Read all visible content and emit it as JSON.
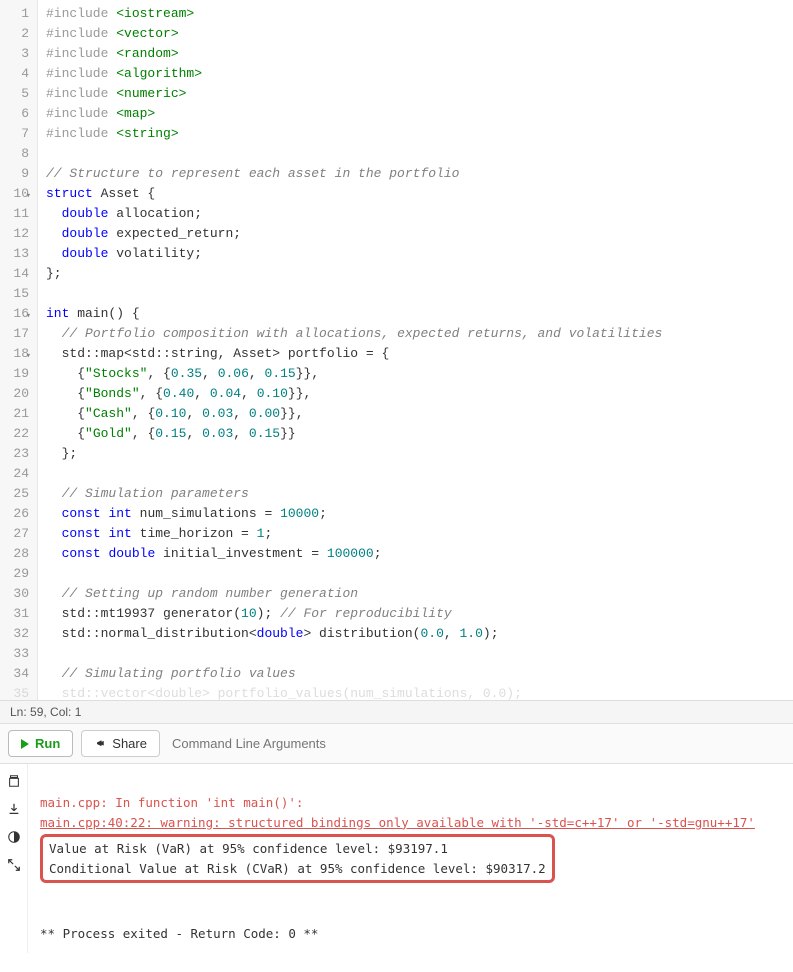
{
  "editor": {
    "lines": [
      {
        "n": 1,
        "tokens": [
          [
            "preproc",
            "#include "
          ],
          [
            "string",
            "<iostream>"
          ]
        ]
      },
      {
        "n": 2,
        "tokens": [
          [
            "preproc",
            "#include "
          ],
          [
            "string",
            "<vector>"
          ]
        ]
      },
      {
        "n": 3,
        "tokens": [
          [
            "preproc",
            "#include "
          ],
          [
            "string",
            "<random>"
          ]
        ]
      },
      {
        "n": 4,
        "tokens": [
          [
            "preproc",
            "#include "
          ],
          [
            "string",
            "<algorithm>"
          ]
        ]
      },
      {
        "n": 5,
        "tokens": [
          [
            "preproc",
            "#include "
          ],
          [
            "string",
            "<numeric>"
          ]
        ]
      },
      {
        "n": 6,
        "tokens": [
          [
            "preproc",
            "#include "
          ],
          [
            "string",
            "<map>"
          ]
        ]
      },
      {
        "n": 7,
        "tokens": [
          [
            "preproc",
            "#include "
          ],
          [
            "string",
            "<string>"
          ]
        ]
      },
      {
        "n": 8,
        "tokens": []
      },
      {
        "n": 9,
        "tokens": [
          [
            "comment",
            "// Structure to represent each asset in the portfolio"
          ]
        ]
      },
      {
        "n": 10,
        "fold": true,
        "tokens": [
          [
            "keyword",
            "struct"
          ],
          [
            "ident",
            " Asset "
          ],
          [
            "punct",
            "{"
          ]
        ]
      },
      {
        "n": 11,
        "tokens": [
          [
            "ident",
            "  "
          ],
          [
            "type",
            "double"
          ],
          [
            "ident",
            " allocation;"
          ]
        ]
      },
      {
        "n": 12,
        "tokens": [
          [
            "ident",
            "  "
          ],
          [
            "type",
            "double"
          ],
          [
            "ident",
            " expected_return;"
          ]
        ]
      },
      {
        "n": 13,
        "tokens": [
          [
            "ident",
            "  "
          ],
          [
            "type",
            "double"
          ],
          [
            "ident",
            " volatility;"
          ]
        ]
      },
      {
        "n": 14,
        "tokens": [
          [
            "punct",
            "};"
          ]
        ]
      },
      {
        "n": 15,
        "tokens": []
      },
      {
        "n": 16,
        "fold": true,
        "tokens": [
          [
            "type",
            "int"
          ],
          [
            "ident",
            " main() "
          ],
          [
            "punct",
            "{"
          ]
        ]
      },
      {
        "n": 17,
        "tokens": [
          [
            "ident",
            "  "
          ],
          [
            "comment",
            "// Portfolio composition with allocations, expected returns, and volatilities"
          ]
        ]
      },
      {
        "n": 18,
        "fold": true,
        "tokens": [
          [
            "ident",
            "  std::map<std::string, Asset> portfolio = "
          ],
          [
            "punct",
            "{"
          ]
        ]
      },
      {
        "n": 19,
        "tokens": [
          [
            "ident",
            "    "
          ],
          [
            "punct",
            "{"
          ],
          [
            "string",
            "\"Stocks\""
          ],
          [
            "punct",
            ", {"
          ],
          [
            "number",
            "0.35"
          ],
          [
            "punct",
            ", "
          ],
          [
            "number",
            "0.06"
          ],
          [
            "punct",
            ", "
          ],
          [
            "number",
            "0.15"
          ],
          [
            "punct",
            "}},"
          ]
        ]
      },
      {
        "n": 20,
        "tokens": [
          [
            "ident",
            "    "
          ],
          [
            "punct",
            "{"
          ],
          [
            "string",
            "\"Bonds\""
          ],
          [
            "punct",
            ", {"
          ],
          [
            "number",
            "0.40"
          ],
          [
            "punct",
            ", "
          ],
          [
            "number",
            "0.04"
          ],
          [
            "punct",
            ", "
          ],
          [
            "number",
            "0.10"
          ],
          [
            "punct",
            "}},"
          ]
        ]
      },
      {
        "n": 21,
        "tokens": [
          [
            "ident",
            "    "
          ],
          [
            "punct",
            "{"
          ],
          [
            "string",
            "\"Cash\""
          ],
          [
            "punct",
            ", {"
          ],
          [
            "number",
            "0.10"
          ],
          [
            "punct",
            ", "
          ],
          [
            "number",
            "0.03"
          ],
          [
            "punct",
            ", "
          ],
          [
            "number",
            "0.00"
          ],
          [
            "punct",
            "}},"
          ]
        ]
      },
      {
        "n": 22,
        "tokens": [
          [
            "ident",
            "    "
          ],
          [
            "punct",
            "{"
          ],
          [
            "string",
            "\"Gold\""
          ],
          [
            "punct",
            ", {"
          ],
          [
            "number",
            "0.15"
          ],
          [
            "punct",
            ", "
          ],
          [
            "number",
            "0.03"
          ],
          [
            "punct",
            ", "
          ],
          [
            "number",
            "0.15"
          ],
          [
            "punct",
            "}}"
          ]
        ]
      },
      {
        "n": 23,
        "tokens": [
          [
            "ident",
            "  "
          ],
          [
            "punct",
            "};"
          ]
        ]
      },
      {
        "n": 24,
        "tokens": []
      },
      {
        "n": 25,
        "tokens": [
          [
            "ident",
            "  "
          ],
          [
            "comment",
            "// Simulation parameters"
          ]
        ]
      },
      {
        "n": 26,
        "tokens": [
          [
            "ident",
            "  "
          ],
          [
            "keyword",
            "const"
          ],
          [
            "ident",
            " "
          ],
          [
            "type",
            "int"
          ],
          [
            "ident",
            " num_simulations = "
          ],
          [
            "number",
            "10000"
          ],
          [
            "punct",
            ";"
          ]
        ]
      },
      {
        "n": 27,
        "tokens": [
          [
            "ident",
            "  "
          ],
          [
            "keyword",
            "const"
          ],
          [
            "ident",
            " "
          ],
          [
            "type",
            "int"
          ],
          [
            "ident",
            " time_horizon = "
          ],
          [
            "number",
            "1"
          ],
          [
            "punct",
            ";"
          ]
        ]
      },
      {
        "n": 28,
        "tokens": [
          [
            "ident",
            "  "
          ],
          [
            "keyword",
            "const"
          ],
          [
            "ident",
            " "
          ],
          [
            "type",
            "double"
          ],
          [
            "ident",
            " initial_investment = "
          ],
          [
            "number",
            "100000"
          ],
          [
            "punct",
            ";"
          ]
        ]
      },
      {
        "n": 29,
        "tokens": []
      },
      {
        "n": 30,
        "tokens": [
          [
            "ident",
            "  "
          ],
          [
            "comment",
            "// Setting up random number generation"
          ]
        ]
      },
      {
        "n": 31,
        "tokens": [
          [
            "ident",
            "  std::mt19937 generator("
          ],
          [
            "number",
            "10"
          ],
          [
            "ident",
            "); "
          ],
          [
            "comment",
            "// For reproducibility"
          ]
        ]
      },
      {
        "n": 32,
        "tokens": [
          [
            "ident",
            "  std::normal_distribution<"
          ],
          [
            "type",
            "double"
          ],
          [
            "ident",
            "> distribution("
          ],
          [
            "number",
            "0.0"
          ],
          [
            "punct",
            ", "
          ],
          [
            "number",
            "1.0"
          ],
          [
            "punct",
            ");"
          ]
        ]
      },
      {
        "n": 33,
        "tokens": []
      },
      {
        "n": 34,
        "tokens": [
          [
            "ident",
            "  "
          ],
          [
            "comment",
            "// Simulating portfolio values"
          ]
        ]
      }
    ],
    "cutoff_line": "  std::vector<double> portfolio_values(num_simulations, 0.0);"
  },
  "status": {
    "text": "Ln: 59,  Col: 1"
  },
  "toolbar": {
    "run_label": "Run",
    "share_label": "Share",
    "cmd_placeholder": "Command Line Arguments"
  },
  "output": {
    "warn1": "main.cpp: In function 'int main()':",
    "warn2": "main.cpp:40:22: warning: structured bindings only available with '-std=c++17' or '-std=gnu++17'",
    "result1": "Value at Risk (VaR) at 95% confidence level: $93197.1",
    "result2": "Conditional Value at Risk (CVaR) at 95% confidence level: $90317.2",
    "exit": "** Process exited - Return Code: 0 **"
  }
}
